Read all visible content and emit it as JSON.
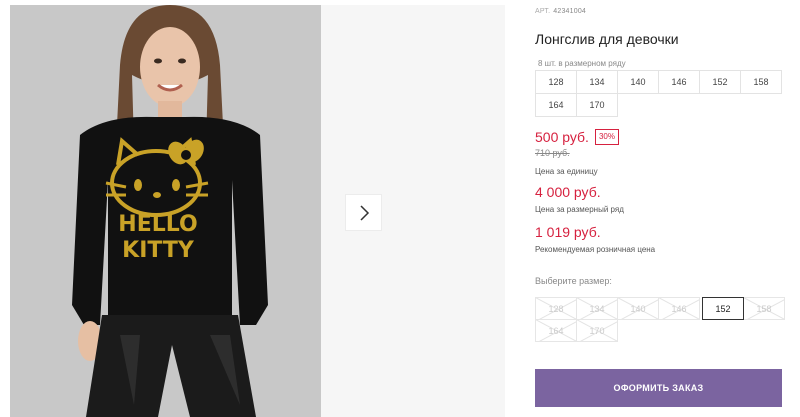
{
  "product": {
    "sku_label": "АРТ.",
    "sku_value": "42341004",
    "title": "Лонгслив для девочки",
    "pack_note": "8 шт. в размерном ряду",
    "pack_sizes": [
      "128",
      "134",
      "140",
      "146",
      "152",
      "158",
      "164",
      "170"
    ],
    "print_text_line1": "HELLO",
    "print_text_line2": "KITTY"
  },
  "pricing": {
    "unit_price": "500 руб.",
    "discount": "30%",
    "old_price": "710 руб.",
    "unit_label": "Цена за единицу",
    "row_price": "4 000 руб.",
    "row_label": "Цена за размерный ряд",
    "recommended_price": "1 019 руб.",
    "recommended_label": "Рекомендуемая розничная цена"
  },
  "size_select": {
    "label": "Выберите размер:",
    "options": [
      {
        "label": "128",
        "available": false
      },
      {
        "label": "134",
        "available": false
      },
      {
        "label": "140",
        "available": false
      },
      {
        "label": "146",
        "available": false
      },
      {
        "label": "152",
        "available": true,
        "selected": true
      },
      {
        "label": "158",
        "available": false
      },
      {
        "label": "164",
        "available": false
      },
      {
        "label": "170",
        "available": false
      }
    ]
  },
  "actions": {
    "order_label": "ОФОРМИТЬ ЗАКАЗ"
  },
  "colors": {
    "accent_purple": "#7b64a0",
    "price_red": "#d6213f",
    "print_gold": "#c9a227"
  },
  "icons": {
    "next": "chevron-right-icon"
  }
}
